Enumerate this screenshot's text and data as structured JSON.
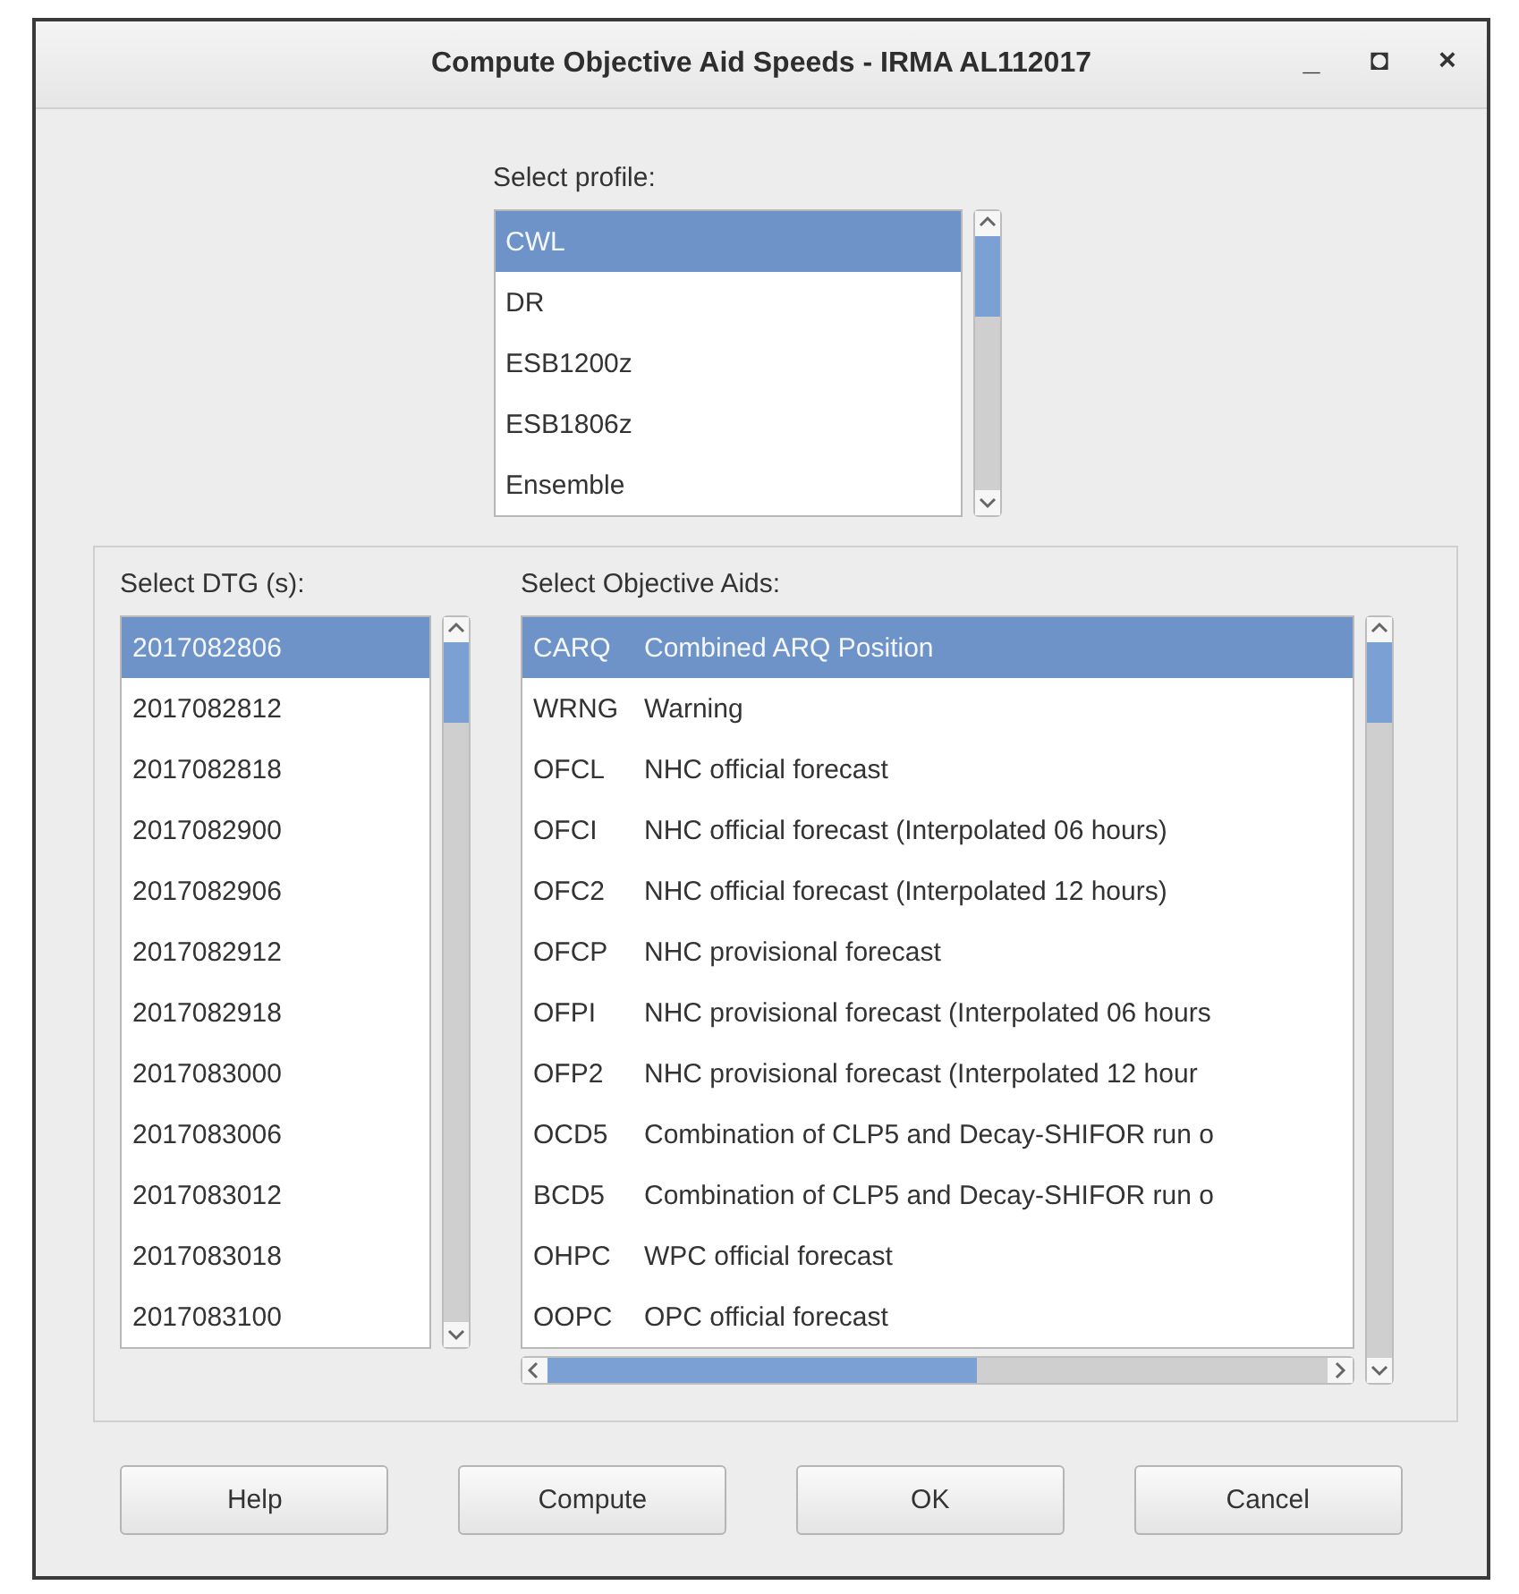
{
  "window": {
    "title": "Compute Objective Aid Speeds - IRMA AL112017",
    "controls": [
      "_",
      "◘",
      "×"
    ]
  },
  "profile": {
    "label": "Select profile:",
    "items": [
      {
        "label": "CWL",
        "selected": true
      },
      {
        "label": "DR",
        "selected": false
      },
      {
        "label": "ESB1200z",
        "selected": false
      },
      {
        "label": "ESB1806z",
        "selected": false
      },
      {
        "label": "Ensemble",
        "selected": false
      }
    ]
  },
  "dtg": {
    "label": "Select DTG (s):",
    "items": [
      {
        "label": "2017082806",
        "selected": true
      },
      {
        "label": "2017082812",
        "selected": false
      },
      {
        "label": "2017082818",
        "selected": false
      },
      {
        "label": "2017082900",
        "selected": false
      },
      {
        "label": "2017082906",
        "selected": false
      },
      {
        "label": "2017082912",
        "selected": false
      },
      {
        "label": "2017082918",
        "selected": false
      },
      {
        "label": "2017083000",
        "selected": false
      },
      {
        "label": "2017083006",
        "selected": false
      },
      {
        "label": "2017083012",
        "selected": false
      },
      {
        "label": "2017083018",
        "selected": false
      },
      {
        "label": "2017083100",
        "selected": false
      }
    ]
  },
  "aids": {
    "label": "Select Objective Aids:",
    "items": [
      {
        "code": "CARQ",
        "description": "Combined ARQ Position",
        "selected": true
      },
      {
        "code": "WRNG",
        "description": "Warning",
        "selected": false
      },
      {
        "code": "OFCL",
        "description": "NHC official forecast",
        "selected": false
      },
      {
        "code": "OFCI",
        "description": "NHC official forecast (Interpolated 06 hours)",
        "selected": false
      },
      {
        "code": "OFC2",
        "description": "NHC official forecast (Interpolated 12 hours)",
        "selected": false
      },
      {
        "code": "OFCP",
        "description": "NHC provisional forecast",
        "selected": false
      },
      {
        "code": "OFPI",
        "description": "NHC provisional forecast (Interpolated 06 hours",
        "selected": false
      },
      {
        "code": "OFP2",
        "description": "NHC provisional forecast (Interpolated 12 hour",
        "selected": false
      },
      {
        "code": "OCD5",
        "description": "Combination of CLP5 and Decay-SHIFOR run o",
        "selected": false
      },
      {
        "code": "BCD5",
        "description": "Combination of CLP5 and Decay-SHIFOR run o",
        "selected": false
      },
      {
        "code": "OHPC",
        "description": "WPC official forecast",
        "selected": false
      },
      {
        "code": "OOPC",
        "description": "OPC official forecast",
        "selected": false
      }
    ]
  },
  "buttons": [
    "Help",
    "Compute",
    "OK",
    "Cancel"
  ]
}
